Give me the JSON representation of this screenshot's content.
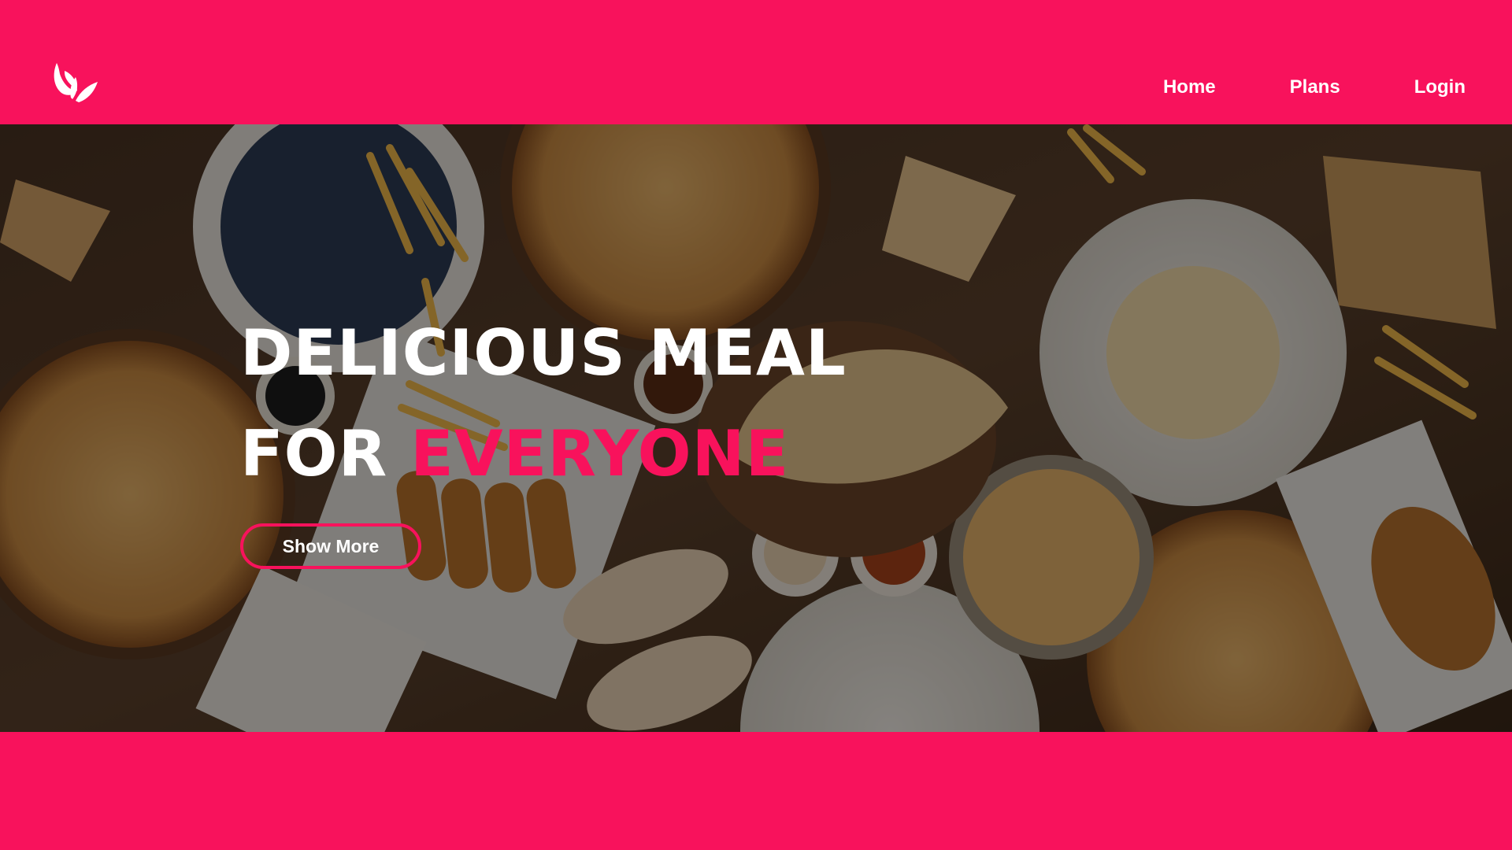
{
  "brand": {
    "logo_icon": "leaf-logo-icon"
  },
  "nav": {
    "items": [
      {
        "label": "Home"
      },
      {
        "label": "Plans"
      },
      {
        "label": "Login"
      }
    ]
  },
  "hero": {
    "line1": "DELICIOUS MEAL",
    "line2_prefix": "FOR ",
    "line2_accent": "EVERYONE",
    "cta_label": "Show More",
    "background_image": "food-table-photo"
  },
  "colors": {
    "accent": "#f8125c",
    "text": "#ffffff"
  }
}
